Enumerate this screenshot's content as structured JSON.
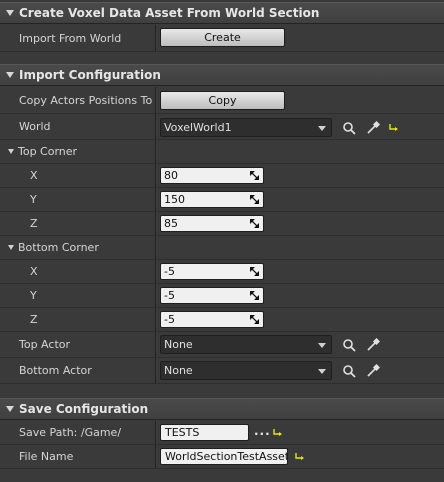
{
  "sections": {
    "create": {
      "title": "Create Voxel Data Asset From World Section"
    },
    "import": {
      "title": "Import Configuration"
    },
    "save": {
      "title": "Save Configuration"
    }
  },
  "create": {
    "import_from_world_label": "Import From World",
    "create_button": "Create"
  },
  "import": {
    "copy_positions_label": "Copy Actors Positions To C",
    "copy_button": "Copy",
    "world_label": "World",
    "world_value": "VoxelWorld1",
    "top_corner_label": "Top Corner",
    "top": {
      "x_label": "X",
      "x": "80",
      "y_label": "Y",
      "y": "150",
      "z_label": "Z",
      "z": "85"
    },
    "bottom_corner_label": "Bottom Corner",
    "bottom": {
      "x_label": "X",
      "x": "-5",
      "y_label": "Y",
      "y": "-5",
      "z_label": "Z",
      "z": "-5"
    },
    "top_actor_label": "Top Actor",
    "top_actor_value": "None",
    "bottom_actor_label": "Bottom Actor",
    "bottom_actor_value": "None"
  },
  "save": {
    "save_path_label": "Save Path: /Game/",
    "save_path_value": "TESTS",
    "file_name_label": "File Name",
    "file_name_value": "WorldSectionTestAsset",
    "browse_dots": "..."
  },
  "colors": {
    "background": "#3a3a3a",
    "header": "#444444",
    "reset_arrow": "#e8e800"
  },
  "icons": [
    "search-icon",
    "eyedropper-icon",
    "reset-arrow-icon",
    "spin-arrows-icon",
    "combo-caret-icon"
  ]
}
